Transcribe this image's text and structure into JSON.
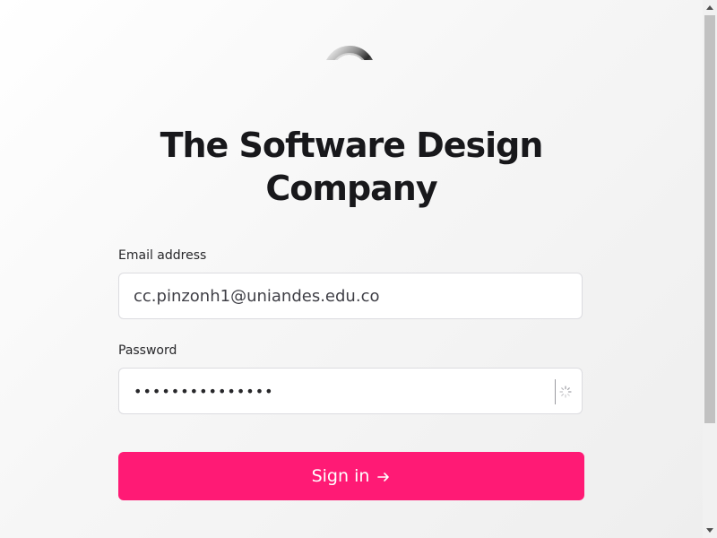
{
  "page": {
    "title": "The Software Design Company",
    "logo_icon": "chrome-ring-logo-icon"
  },
  "form": {
    "email": {
      "label": "Email address",
      "value": "cc.pinzonh1@uniandes.edu.co"
    },
    "password": {
      "label": "Password",
      "masked_value": "•••••••••••••••",
      "icon": "loading-spinner-icon"
    },
    "submit": {
      "label": "Sign in",
      "icon": "arrow-right-icon",
      "color": "#ff1a75"
    }
  },
  "scrollbar": {
    "up_icon": "scroll-up-arrow-icon",
    "down_icon": "scroll-down-arrow-icon"
  }
}
